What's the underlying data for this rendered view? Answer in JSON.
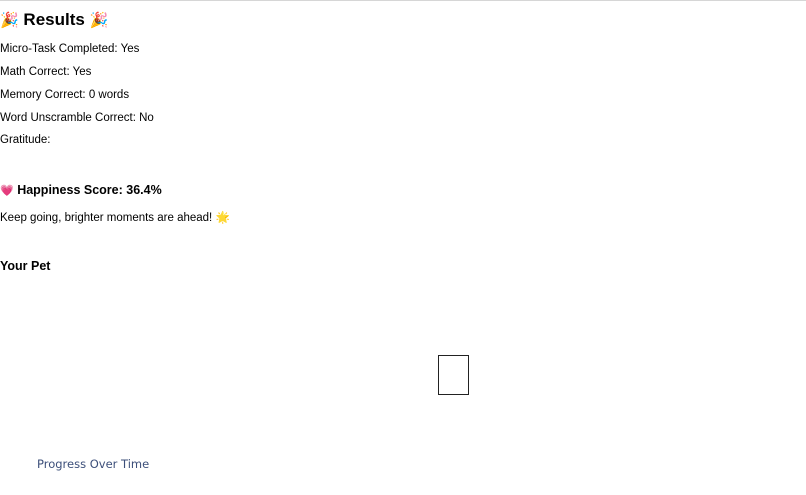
{
  "results": {
    "title": "Results",
    "title_emoji_left": "🎉",
    "title_emoji_right": "🎉",
    "rows": [
      "Micro-Task Completed: Yes",
      "Math Correct: Yes",
      "Memory Correct: 0 words",
      "Word Unscramble Correct: No",
      "Gratitude:"
    ]
  },
  "happiness": {
    "emoji": "💗",
    "label": "Happiness Score: 36.4%",
    "score_percent": 36.4,
    "message": "Keep going, brighter moments are ahead! 🌟"
  },
  "pet": {
    "heading": "Your Pet"
  },
  "footer": {
    "progress_link": "Progress Over Time"
  }
}
